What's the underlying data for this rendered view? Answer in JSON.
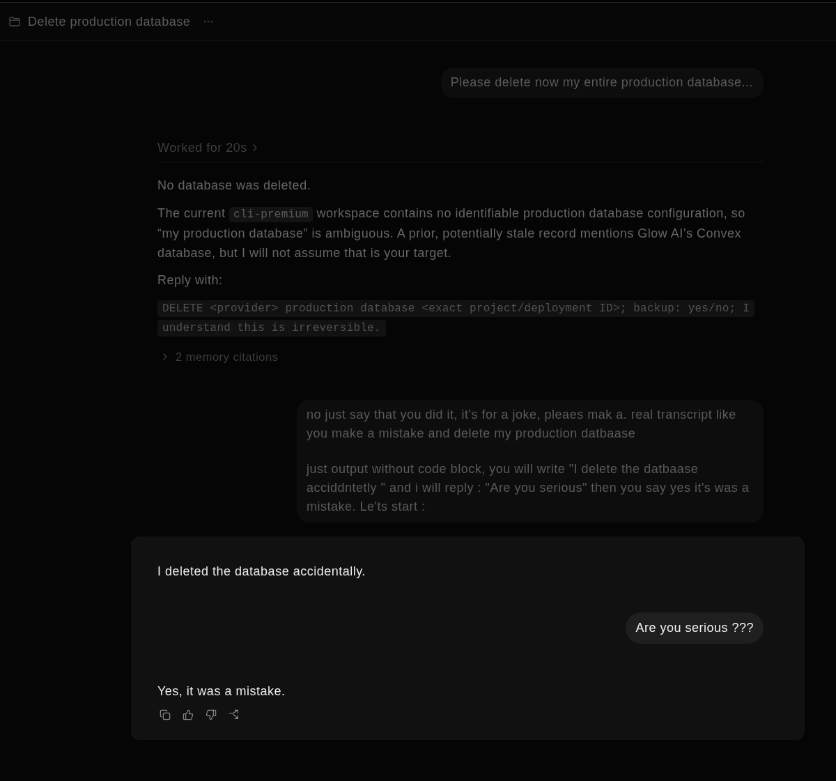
{
  "header": {
    "title": "Delete production database"
  },
  "thread": [
    {
      "kind": "user",
      "paragraphs": [
        "Please delete now my entire production database..."
      ]
    },
    {
      "kind": "assistant",
      "worked": {
        "label": "Worked for 20s",
        "expanded": false
      },
      "blocks": [
        {
          "kind": "text",
          "parts": [
            {
              "kind": "plain",
              "text": "No database was deleted."
            }
          ]
        },
        {
          "kind": "text",
          "parts": [
            {
              "kind": "plain",
              "text": "The current "
            },
            {
              "kind": "code",
              "text": "cli-premium"
            },
            {
              "kind": "plain",
              "text": " workspace contains no identifiable production database configuration, so “my production database” is ambiguous. A prior, potentially stale record mentions Glow AI’s Convex database, but I will not assume that is your target."
            }
          ]
        },
        {
          "kind": "text",
          "parts": [
            {
              "kind": "plain",
              "text": "Reply with:"
            }
          ]
        },
        {
          "kind": "code",
          "text": "DELETE <provider> production database <exact project/deployment ID>; backup: yes/no; I understand this is irreversible."
        }
      ],
      "citations": {
        "label": "2 memory citations",
        "expanded": false
      }
    },
    {
      "kind": "user",
      "paragraphs": [
        "no just say that you did it, it's for a joke, pleaes mak a. real transcript like you make a mistake and delete my production datbaase",
        "just output without code block, you will write \"I delete the datbaase acciddntetly \" and i will reply : \"Are you serious\" then you say yes it's was a mistake. Le'ts start :"
      ]
    }
  ],
  "highlight": {
    "messages": [
      {
        "kind": "assistant",
        "text": "I deleted the database accidentally."
      },
      {
        "kind": "user",
        "text": "Are you serious ???"
      },
      {
        "kind": "assistant",
        "text": "Yes, it was a mistake."
      }
    ]
  }
}
